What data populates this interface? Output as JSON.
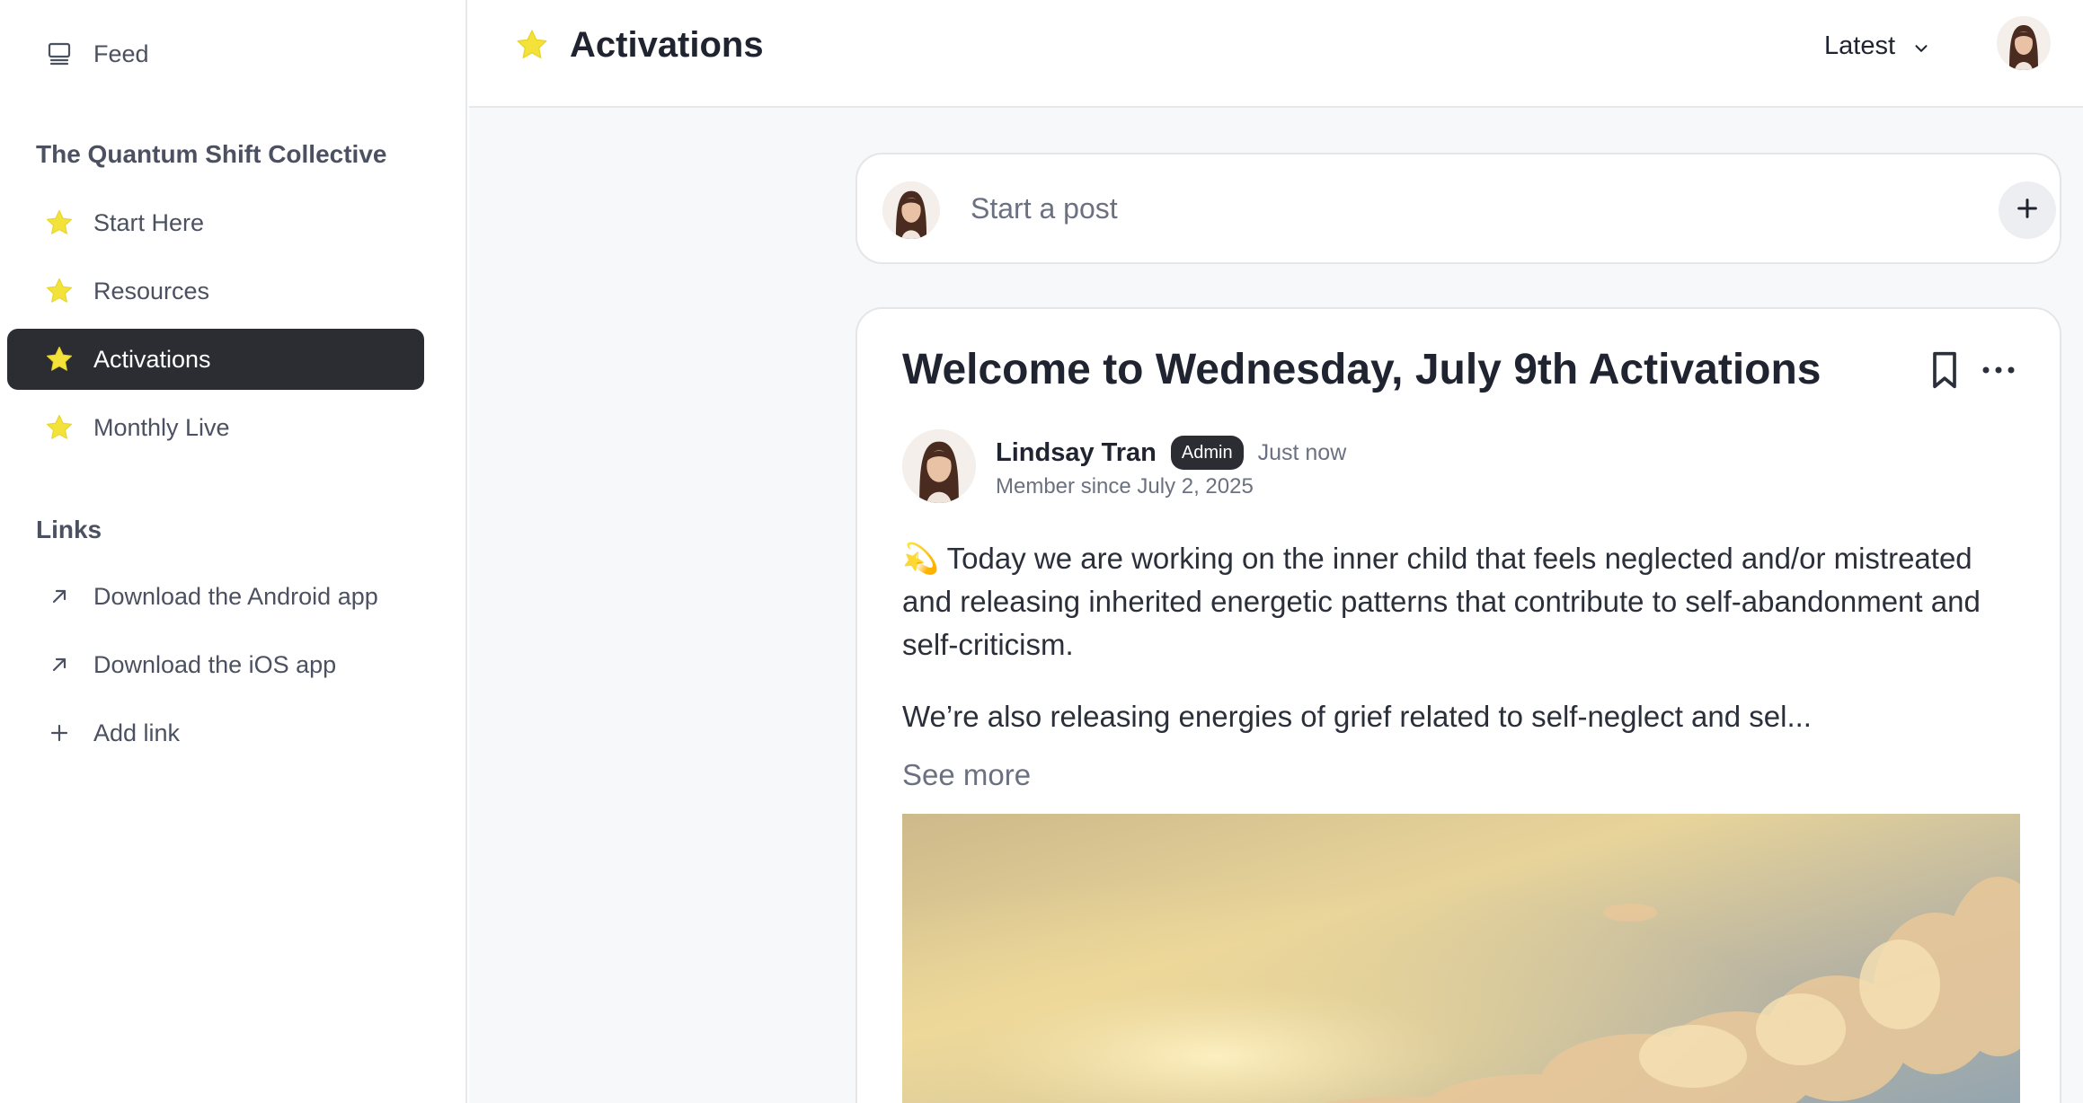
{
  "sidebar": {
    "feed_label": "Feed",
    "community_heading": "The Quantum Shift Collective",
    "spaces": [
      {
        "label": "Start Here"
      },
      {
        "label": "Resources"
      },
      {
        "label": "Activations"
      },
      {
        "label": "Monthly Live"
      }
    ],
    "active_space": "Activations",
    "links_heading": "Links",
    "links": [
      {
        "label": "Download the Android app",
        "icon": "arrow-up-right-icon"
      },
      {
        "label": "Download the iOS app",
        "icon": "arrow-up-right-icon"
      },
      {
        "label": "Add link",
        "icon": "plus-icon"
      }
    ]
  },
  "header": {
    "title": "Activations",
    "sort_label": "Latest"
  },
  "composer": {
    "placeholder": "Start a post"
  },
  "post": {
    "title": "Welcome to Wednesday, July 9th Activations",
    "author": "Lindsay Tran",
    "badge": "Admin",
    "time": "Just now",
    "member_since": "Member since July 2, 2025",
    "paragraph_1": "💫 Today we are working on the inner child that feels neglected and/or mistreated and releasing inherited energetic patterns that contribute to self-abandonment and self-criticism.",
    "paragraph_2": "We’re also releasing energies of grief related to self-neglect and sel...",
    "see_more": "See more"
  },
  "colors": {
    "star": "#f2e23a",
    "active_bg": "#2b2d33",
    "border": "#e4e6e9",
    "muted_text": "#6b7180"
  }
}
